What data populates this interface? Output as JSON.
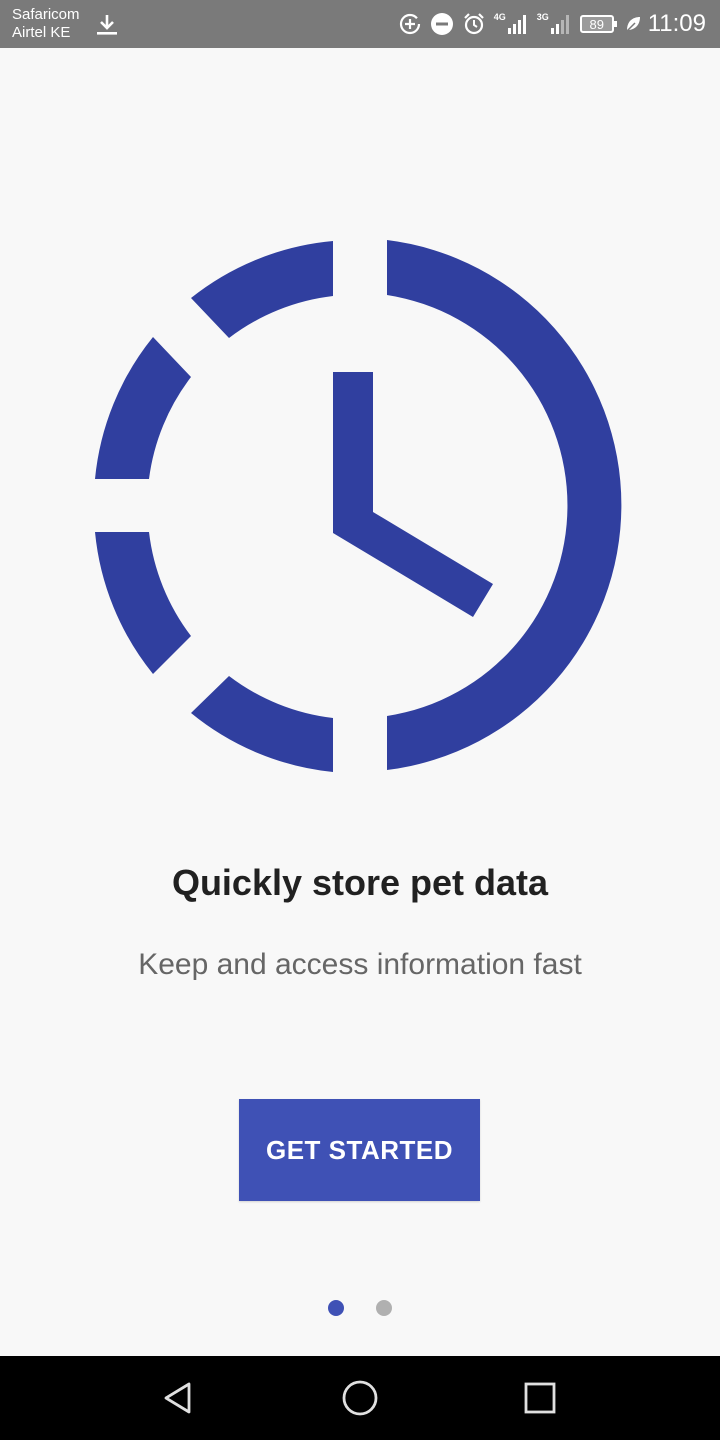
{
  "status_bar": {
    "carrier_1": "Safaricom",
    "carrier_2": "Airtel KE",
    "network_1": "4G",
    "network_2": "3G",
    "battery": "89",
    "time": "11:09",
    "icons": [
      "download-icon",
      "data-saver-icon",
      "do-not-disturb-icon",
      "alarm-icon",
      "signal-icon",
      "signal-icon",
      "battery-icon",
      "leaf-icon"
    ]
  },
  "onboarding": {
    "illustration_icon": "clock-icon",
    "title": "Quickly store pet data",
    "subtitle": "Keep and access information fast",
    "button_label": "GET STARTED",
    "page_count": 2,
    "active_page": 1
  },
  "nav_bar": {
    "icons": [
      "back-icon",
      "home-icon",
      "recents-icon"
    ]
  },
  "colors": {
    "primary": "#3f51b5",
    "illustration": "#303f9f",
    "status_bar": "#7a7a7a",
    "background": "#f8f8f8",
    "inactive_dot": "#b0b0b0"
  }
}
